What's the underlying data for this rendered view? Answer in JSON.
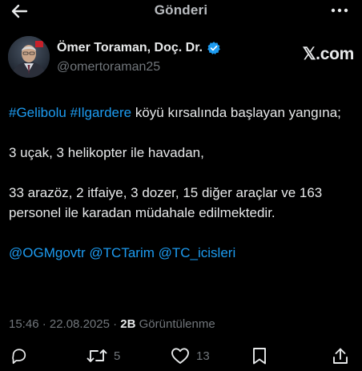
{
  "header": {
    "title": "Gönderi",
    "back_icon": "arrow-left-icon",
    "more_icon": "more-horizontal-icon"
  },
  "author": {
    "name": "Ömer Toraman, Doç. Dr.",
    "handle": "@omertoraman25",
    "verified_icon": "verified-badge-icon",
    "verified_color": "#1d9bf0"
  },
  "watermark": "𝕏.com",
  "tweet": {
    "line1_tag1": "#Gelibolu",
    "line1_tag2": "#Ilgardere",
    "line1_text": " köyü kırsalında başlayan yangına;",
    "line2": "3 uçak, 3 helikopter ile havadan,",
    "line3": "33 arazöz, 2 itfaiye, 3 dozer, 15 diğer araçlar ve 163 personel ile karadan müdahale edilmektedir.",
    "mention1": "@OGMgovtr",
    "mention2": "@TCTarim",
    "mention3": "@TC_icisleri"
  },
  "meta": {
    "time": "15:46 · 22.08.2025 · ",
    "views_count": "2B",
    "views_label": " Görüntülenme"
  },
  "actions": {
    "reply_icon": "reply-icon",
    "retweet_icon": "retweet-icon",
    "retweet_count": "5",
    "like_icon": "heart-icon",
    "like_count": "13",
    "bookmark_icon": "bookmark-icon",
    "share_icon": "share-icon"
  },
  "colors": {
    "background": "#000000",
    "text": "#e7e9ea",
    "muted": "#71767b",
    "link": "#1d9bf0"
  }
}
